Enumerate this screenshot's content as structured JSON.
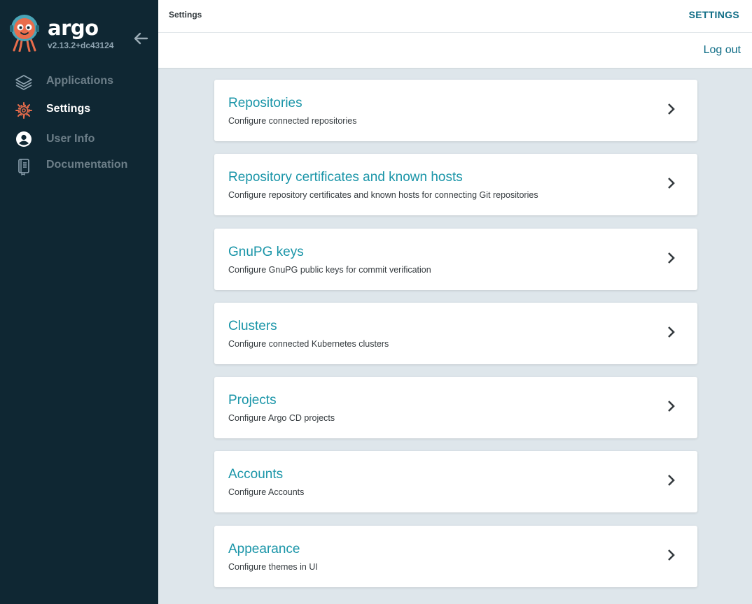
{
  "sidebar": {
    "brand": {
      "name": "argo",
      "version": "v2.13.2+dc43124"
    },
    "items": [
      {
        "label": "Applications",
        "icon": "layers-icon",
        "active": false
      },
      {
        "label": "Settings",
        "icon": "gear-icon",
        "active": true
      },
      {
        "label": "User Info",
        "icon": "user-circle-icon",
        "active": false
      },
      {
        "label": "Documentation",
        "icon": "book-icon",
        "active": false
      }
    ]
  },
  "topbar": {
    "breadcrumb": "Settings",
    "title": "SETTINGS",
    "logout_label": "Log out"
  },
  "cards": [
    {
      "title": "Repositories",
      "description": "Configure connected repositories"
    },
    {
      "title": "Repository certificates and known hosts",
      "description": "Configure repository certificates and known hosts for connecting Git repositories"
    },
    {
      "title": "GnuPG keys",
      "description": "Configure GnuPG public keys for commit verification"
    },
    {
      "title": "Clusters",
      "description": "Configure connected Kubernetes clusters"
    },
    {
      "title": "Projects",
      "description": "Configure Argo CD projects"
    },
    {
      "title": "Accounts",
      "description": "Configure Accounts"
    },
    {
      "title": "Appearance",
      "description": "Configure themes in UI"
    }
  ],
  "colors": {
    "sidebar_bg": "#0f2733",
    "accent": "#1a95a8",
    "settings_icon": "#e96d4c",
    "page_bg": "#dee6eb"
  }
}
